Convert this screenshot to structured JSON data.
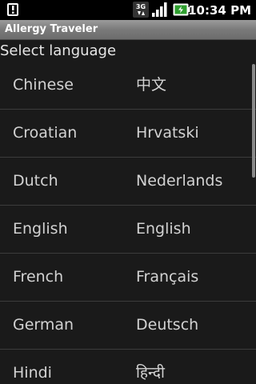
{
  "status_bar": {
    "time": "10:34 PM",
    "network_label": "3G",
    "icons": [
      "notification-icon",
      "3g-icon",
      "signal-icon",
      "battery-icon"
    ]
  },
  "app": {
    "title": "Allergy Traveler"
  },
  "header": {
    "label": "Select language"
  },
  "languages": [
    {
      "english": "Chinese",
      "native": "中文"
    },
    {
      "english": "Croatian",
      "native": "Hrvatski"
    },
    {
      "english": "Dutch",
      "native": "Nederlands"
    },
    {
      "english": "English",
      "native": "English"
    },
    {
      "english": "French",
      "native": "Français"
    },
    {
      "english": "German",
      "native": "Deutsch"
    },
    {
      "english": "Hindi",
      "native": "हिन्दी"
    }
  ],
  "colors": {
    "background": "#1a1a1a",
    "text": "#d2d2d2",
    "divider": "#3c3c3c",
    "title_bar": "#7a7a7a"
  }
}
